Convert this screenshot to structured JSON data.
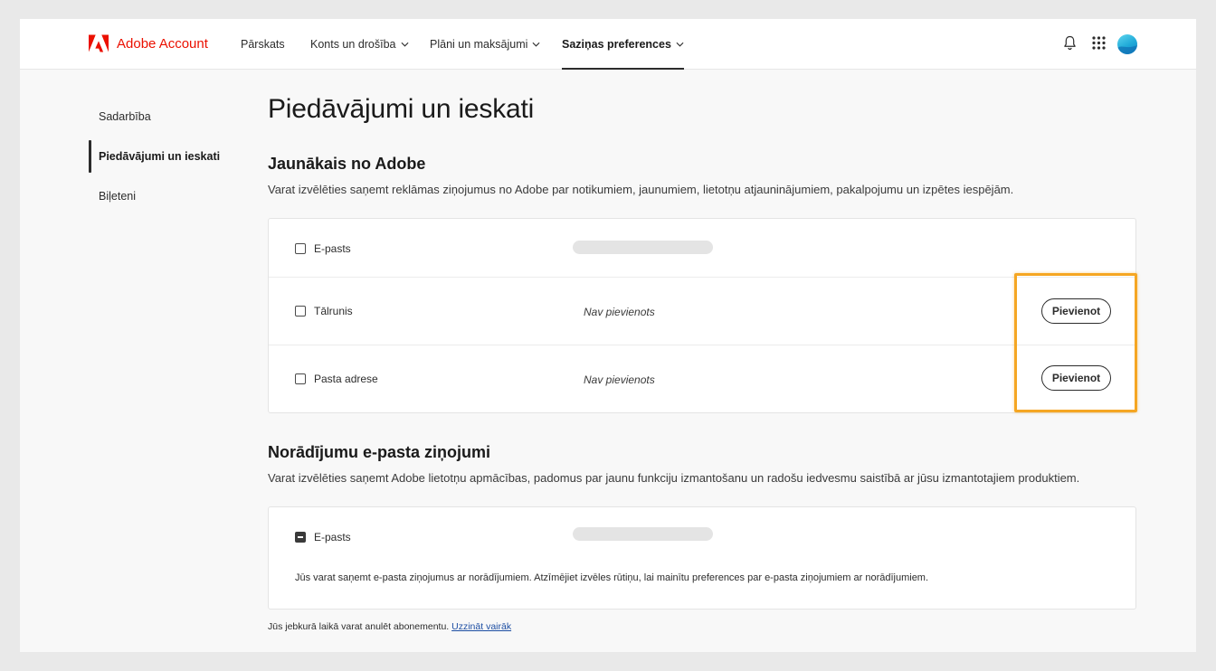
{
  "header": {
    "brand_name": "Adobe Account",
    "nav": [
      {
        "label": "Pārskats",
        "has_dropdown": false,
        "active": false
      },
      {
        "label": "Konts un drošība",
        "has_dropdown": true,
        "active": false
      },
      {
        "label": "Plāni un maksājumi",
        "has_dropdown": true,
        "active": false
      },
      {
        "label": "Saziņas preferences",
        "has_dropdown": true,
        "active": true
      }
    ],
    "icons": [
      "bell-icon",
      "apps-grid-icon",
      "avatar"
    ]
  },
  "sidebar": {
    "items": [
      {
        "label": "Sadarbība",
        "active": false
      },
      {
        "label": "Piedāvājumi un ieskati",
        "active": true
      },
      {
        "label": "Biļeteni",
        "active": false
      }
    ]
  },
  "main": {
    "page_title": "Piedāvājumi un ieskati",
    "section1": {
      "title": "Jaunākais no Adobe",
      "description": "Varat izvēlēties saņemt reklāmas ziņojumus no Adobe par notikumiem, jaunumiem, lietotņu atjauninājumiem, pakalpojumu un izpētes iespējām.",
      "rows": [
        {
          "label": "E-pasts",
          "value": "",
          "checked": false,
          "button": ""
        },
        {
          "label": "Tālrunis",
          "value": "Nav pievienots",
          "checked": false,
          "button": "Pievienot"
        },
        {
          "label": "Pasta adrese",
          "value": "Nav pievienots",
          "checked": false,
          "button": "Pievienot"
        }
      ]
    },
    "section2": {
      "title": "Norādījumu e-pasta ziņojumi",
      "description": "Varat izvēlēties saņemt Adobe lietotņu apmācības, padomus par jaunu funkciju izmantošanu un radošu iedvesmu saistībā ar jūsu izmantotajiem produktiem.",
      "row": {
        "label": "E-pasts",
        "state": "indeterminate"
      },
      "note": "Jūs varat saņemt e-pasta ziņojumus ar norādījumiem. Atzīmējiet izvēles rūtiņu, lai mainītu preferences par e-pasta ziņojumiem ar norādījumiem."
    },
    "footer": {
      "text": "Jūs jebkurā laikā varat anulēt abonementu.",
      "link": "Uzzināt vairāk"
    }
  },
  "colors": {
    "brand_red": "#eb1000",
    "highlight_orange": "#f5a623",
    "link_blue": "#1d4ea3"
  }
}
